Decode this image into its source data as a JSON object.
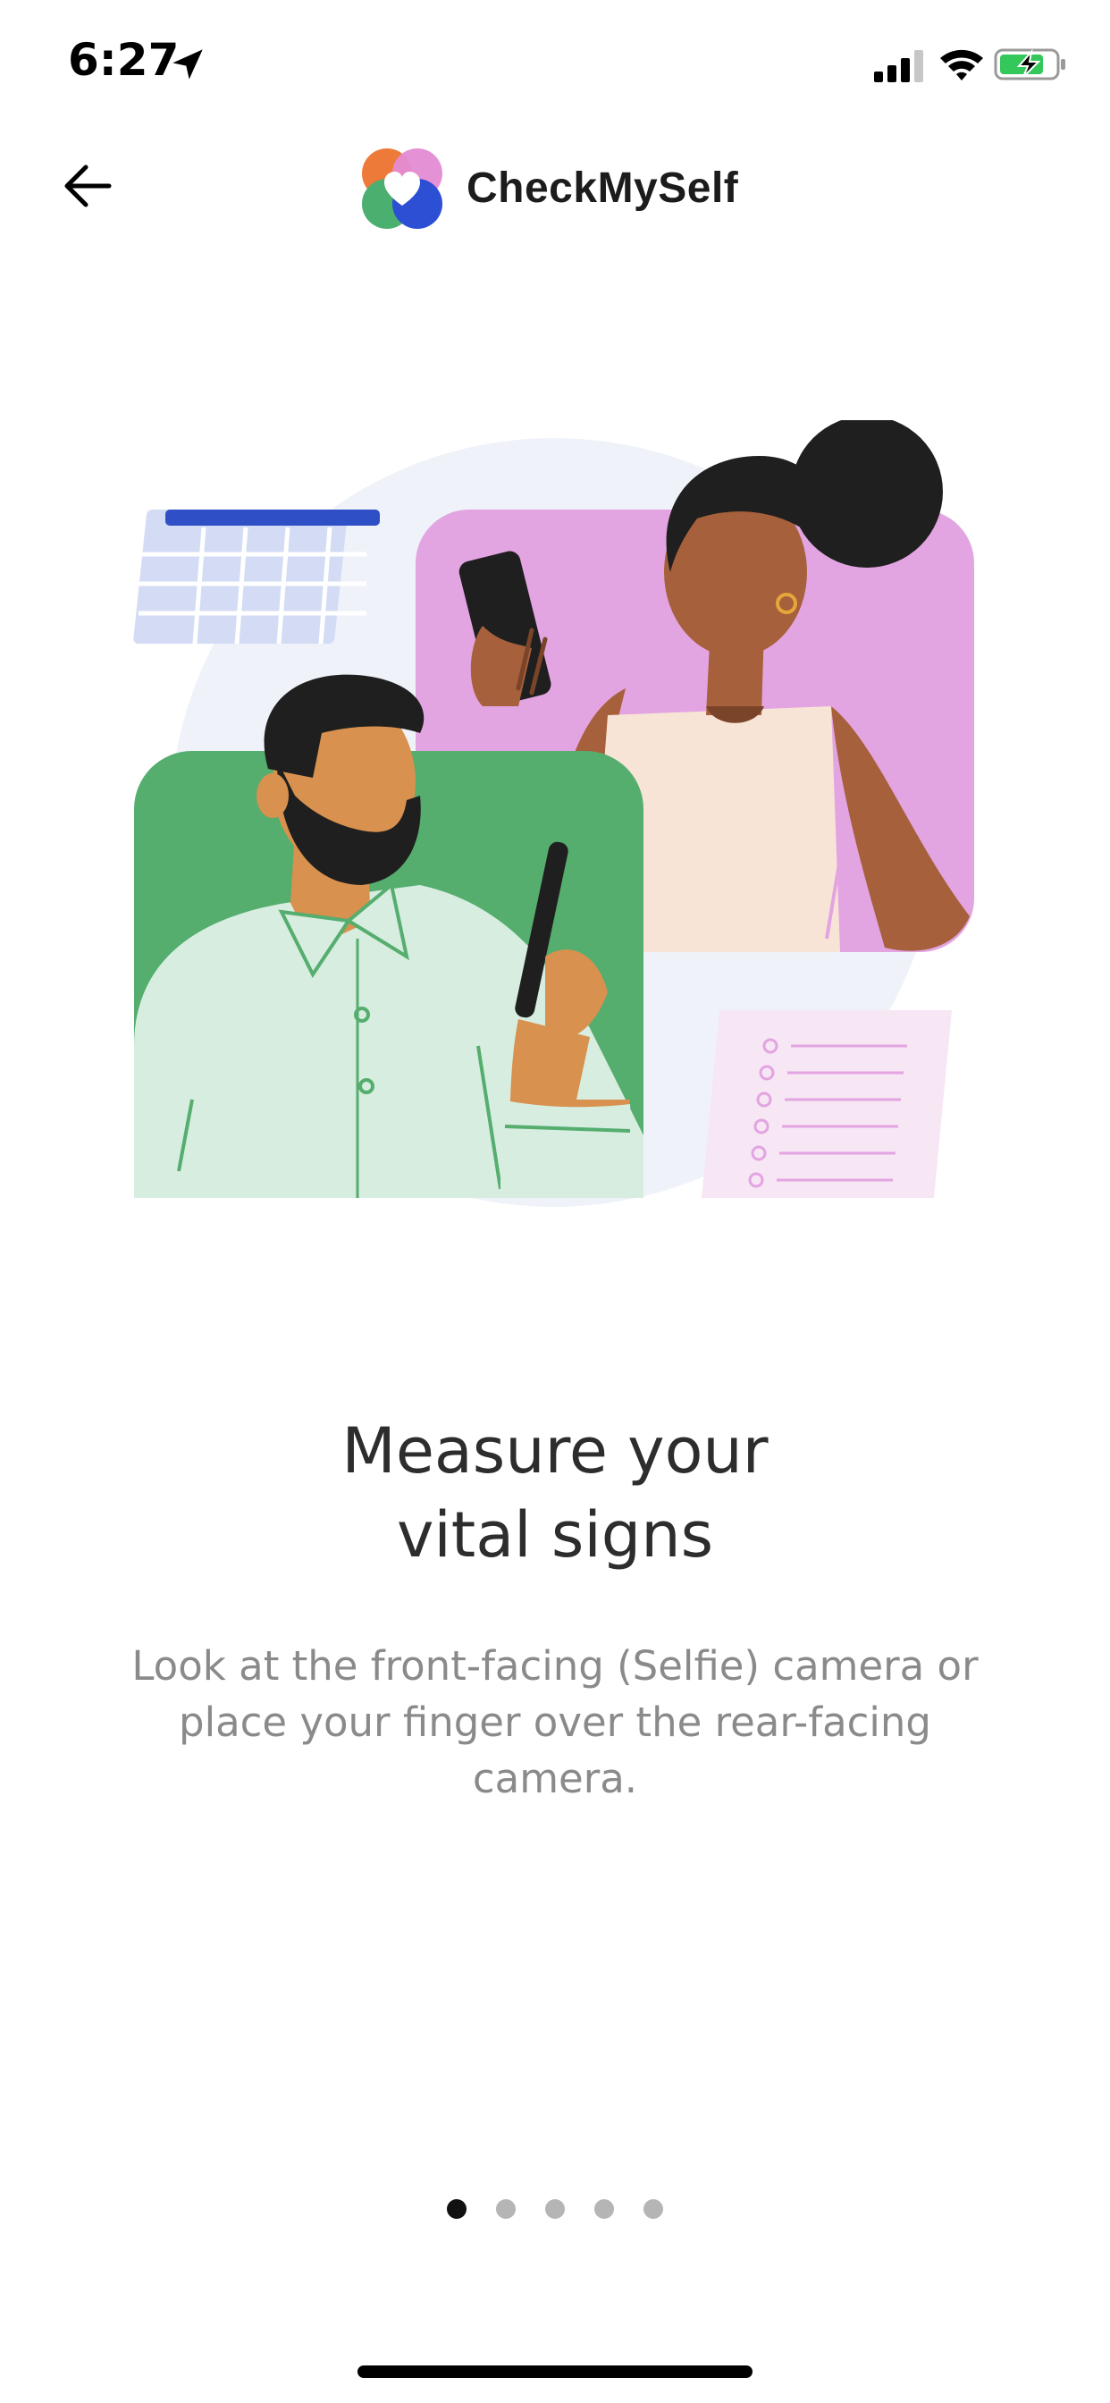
{
  "status_bar": {
    "time": "6:27",
    "icons": [
      "location-arrow-icon",
      "signal-icon",
      "wifi-icon",
      "battery-charging-icon"
    ]
  },
  "header": {
    "back_icon": "arrow-left-icon",
    "app_name": "CheckMySelf"
  },
  "onboarding": {
    "headline_line1": "Measure your",
    "headline_line2": "vital signs",
    "description_line1": "Look at the front-facing (Selfie) camera or",
    "description_line2": "place your finger over the rear-facing",
    "description_line3": "camera."
  },
  "pager": {
    "total_pages": 5,
    "current_page": 1
  },
  "colors": {
    "accent_green": "#55ad6e",
    "accent_purple": "#e3a4e2",
    "calendar_blue": "#2f4fc6",
    "logo_orange": "#ee7a3a",
    "logo_pink": "#e48bd3",
    "logo_green": "#4bb06f",
    "logo_blue": "#2c4fd3"
  }
}
